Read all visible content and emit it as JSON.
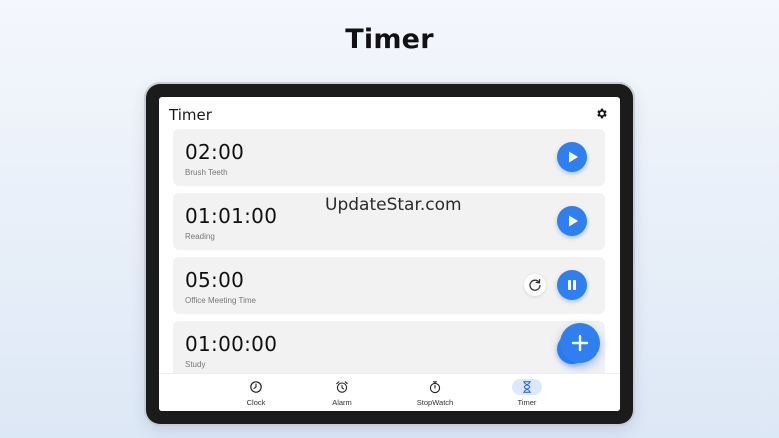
{
  "headline": "Timer",
  "app": {
    "title": "Timer",
    "settings_icon": "gear-icon"
  },
  "timers": [
    {
      "time": "02:00",
      "label": "Brush Teeth",
      "state": "paused",
      "action_icon": "play-icon"
    },
    {
      "time": "01:01:00",
      "label": "Reading",
      "state": "paused",
      "action_icon": "play-icon"
    },
    {
      "time": "05:00",
      "label": "Office Meeting Time",
      "state": "running",
      "action_icon": "pause-icon",
      "secondary_icon": "reset-icon"
    },
    {
      "time": "01:00:00",
      "label": "Study",
      "state": "paused",
      "action_icon": "play-icon"
    }
  ],
  "watermark": "UpdateStar.com",
  "fab_icon": "plus-icon",
  "nav": [
    {
      "label": "Clock",
      "icon": "clock-icon",
      "active": false
    },
    {
      "label": "Alarm",
      "icon": "alarm-icon",
      "active": false
    },
    {
      "label": "StopWatch",
      "icon": "stopwatch-icon",
      "active": false
    },
    {
      "label": "Timer",
      "icon": "hourglass-icon",
      "active": true
    }
  ],
  "colors": {
    "accent": "#2f7ff0",
    "card_bg": "#f2f2f2",
    "nav_active_bg": "#dce8fb",
    "device_frame": "#1b1b1b"
  }
}
